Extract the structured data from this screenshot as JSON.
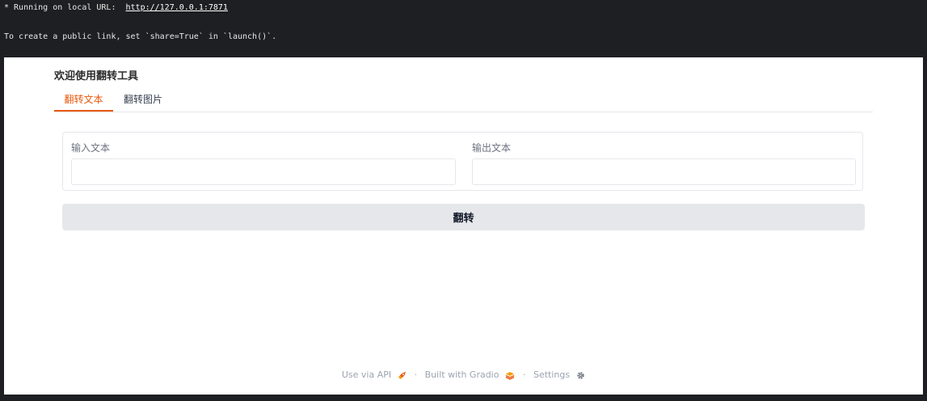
{
  "terminal": {
    "line1_prefix": "* Running on local URL:  ",
    "local_url": "http://127.0.0.1:7871",
    "line2": "To create a public link, set `share=True` in `launch()`."
  },
  "app": {
    "title": "欢迎使用翻转工具",
    "tabs": [
      {
        "label": "翻转文本",
        "active": true
      },
      {
        "label": "翻转图片",
        "active": false
      }
    ],
    "input_label": "输入文本",
    "input_value": "",
    "output_label": "输出文本",
    "output_value": "",
    "flip_button": "翻转"
  },
  "footer": {
    "api_label": "Use via API",
    "api_icon": "rocket-icon",
    "separator": "·",
    "built_label": "Built with Gradio",
    "built_icon": "gradio-logo-icon",
    "settings_label": "Settings",
    "settings_icon": "gear-icon"
  },
  "colors": {
    "accent": "#ea580c",
    "button_bg": "#e5e7eb",
    "terminal_bg": "#1e1f22"
  }
}
